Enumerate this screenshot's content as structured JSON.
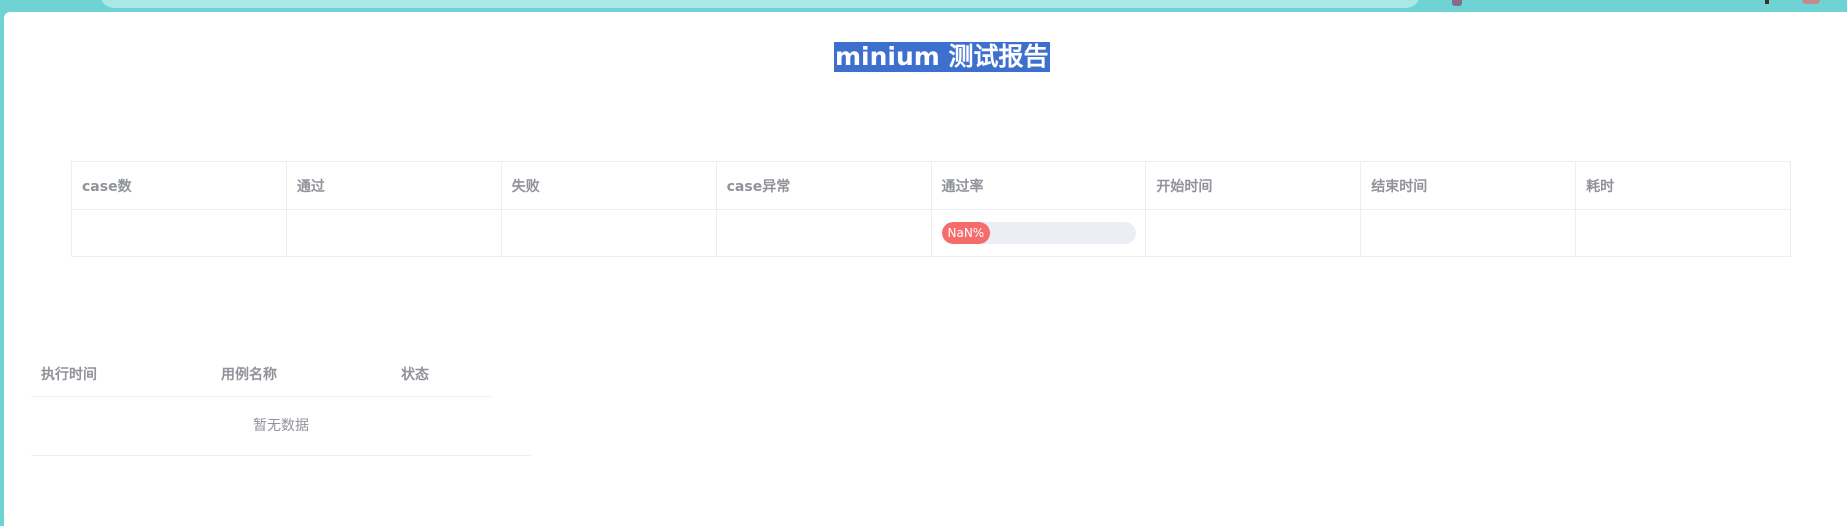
{
  "report": {
    "title": "minium 测试报告"
  },
  "summary": {
    "headers": [
      "case数",
      "通过",
      "失败",
      "case异常",
      "通过率",
      "开始时间",
      "结束时间",
      "耗时"
    ],
    "row": {
      "case_count": "",
      "passed": "",
      "failed": "",
      "case_error": "",
      "pass_rate_text": "NaN%",
      "pass_rate_fraction": 0,
      "start_time": "",
      "end_time": "",
      "duration": ""
    }
  },
  "details": {
    "headers": [
      "执行时间",
      "用例名称",
      "状态"
    ],
    "empty_text": "暂无数据"
  },
  "colors": {
    "progress_fill": "#f56c6c",
    "progress_track": "#ebeef5",
    "title_highlight": "#3d6fcf",
    "border": "#ebeef5",
    "header_text": "#909399",
    "browser_chrome": "#6fd3d3"
  }
}
